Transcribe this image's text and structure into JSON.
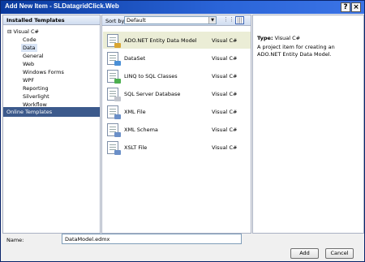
{
  "window": {
    "title": "Add New Item - SLDatagridClick.Web",
    "help_glyph": "?",
    "close_glyph": "×"
  },
  "left_pane": {
    "header": "Installed Templates",
    "tree_root": "Visual C#",
    "expander_glyph": "⊟",
    "items": [
      {
        "label": "Code"
      },
      {
        "label": "Data"
      },
      {
        "label": "General"
      },
      {
        "label": "Web"
      },
      {
        "label": "Windows Forms"
      },
      {
        "label": "WPF"
      },
      {
        "label": "Reporting"
      },
      {
        "label": "Silverlight"
      },
      {
        "label": "Workflow"
      }
    ],
    "online_templates": "Online Templates"
  },
  "center_pane": {
    "sort_label": "Sort by:",
    "sort_value": "Default",
    "sort_arrow": "▼",
    "view_list_glyph": "⋮⋮",
    "view_details_glyph": "|||",
    "templates": [
      {
        "name": "ADO.NET Entity Data Model",
        "type": "Visual C#",
        "icon": "entity-data-model-icon",
        "badge_color": "#d9a632"
      },
      {
        "name": "DataSet",
        "type": "Visual C#",
        "icon": "dataset-icon",
        "badge_color": "#4a8fd6"
      },
      {
        "name": "LINQ to SQL Classes",
        "type": "Visual C#",
        "icon": "linq-to-sql-icon",
        "badge_color": "#4caf50"
      },
      {
        "name": "SQL Server Database",
        "type": "Visual C#",
        "icon": "sql-database-icon",
        "badge_color": "#c0c4cc"
      },
      {
        "name": "XML File",
        "type": "Visual C#",
        "icon": "xml-file-icon",
        "badge_color": "#6a8fc8"
      },
      {
        "name": "XML Schema",
        "type": "Visual C#",
        "icon": "xml-schema-icon",
        "badge_color": "#6a8fc8"
      },
      {
        "name": "XSLT File",
        "type": "Visual C#",
        "icon": "xslt-file-icon",
        "badge_color": "#6a8fc8"
      }
    ]
  },
  "right_pane": {
    "type_label": "Type:",
    "type_value": "Visual C#",
    "description": "A project item for creating an ADO.NET Entity Data Model."
  },
  "bottom": {
    "name_label": "Name:",
    "name_value": "DataModel.edmx",
    "add_label": "Add",
    "cancel_label": "Cancel"
  }
}
